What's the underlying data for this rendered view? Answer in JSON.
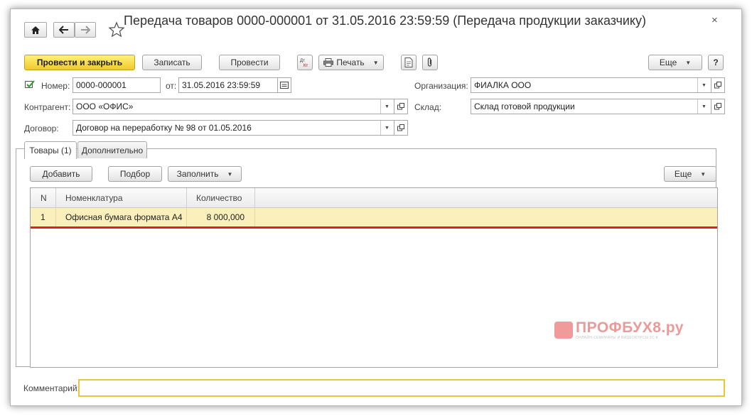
{
  "window": {
    "title": "Передача товаров 0000-000001 от 31.05.2016 23:59:59 (Передача продукции заказчику)",
    "close_symbol": "×"
  },
  "nav": {
    "home_icon": "home-icon",
    "back_icon": "arrow-left-icon",
    "forward_icon": "arrow-right-icon",
    "favorite_icon": "star-icon"
  },
  "toolbar": {
    "post_close_label": "Провести и закрыть",
    "save_label": "Записать",
    "post_label": "Провести",
    "print_label": "Печать",
    "more_label": "Еще",
    "help_label": "?",
    "dropdown_arrow": "▼"
  },
  "form": {
    "number_label": "Номер:",
    "number_value": "0000-000001",
    "date_label": "от:",
    "date_value": "31.05.2016 23:59:59",
    "org_label": "Организация:",
    "org_value": "ФИАЛКА ООО",
    "counterparty_label": "Контрагент:",
    "counterparty_value": "ООО «ОФИС»",
    "warehouse_label": "Склад:",
    "warehouse_value": "Склад готовой продукции",
    "contract_label": "Договор:",
    "contract_value": "Договор на переработку № 98 от 01.05.2016"
  },
  "tabs": [
    {
      "label": "Товары (1)"
    },
    {
      "label": "Дополнительно"
    }
  ],
  "table_toolbar": {
    "add_label": "Добавить",
    "pick_label": "Подбор",
    "fill_label": "Заполнить",
    "more_label": "Еще"
  },
  "table": {
    "columns": [
      "N",
      "Номенклатура",
      "Количество"
    ],
    "rows": [
      {
        "n": "1",
        "item": "Офисная бумага формата А4",
        "qty": "8 000,000"
      }
    ]
  },
  "watermark": {
    "text": "ПРОФБУХ8.ру",
    "subtext": "ОНЛАЙН-СЕМИНАРЫ И ВИДЕОКУРСЫ 1С:8"
  },
  "comment": {
    "label": "Комментарий:",
    "value": ""
  },
  "colors": {
    "primary_button": "#f5d53a",
    "selected_row": "#fbf0bb",
    "highlight_line": "#e02020",
    "comment_border": "#e8c73a"
  }
}
